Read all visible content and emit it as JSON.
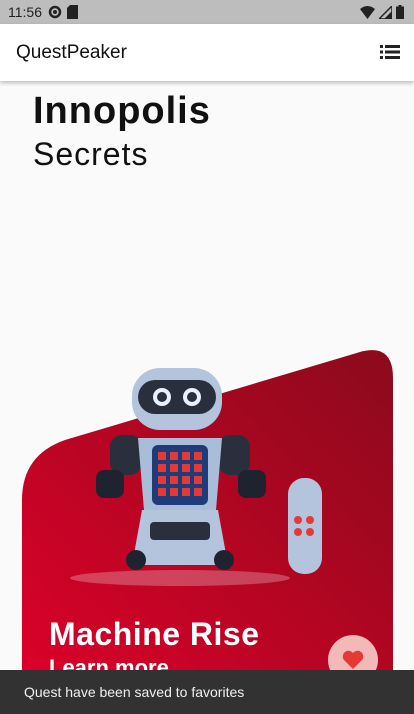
{
  "status_bar": {
    "time": "11:56",
    "icons": [
      "settings-icon",
      "sd-card-icon",
      "wifi-icon",
      "signal-icon",
      "battery-icon"
    ]
  },
  "app_bar": {
    "title": "QuestPeaker",
    "menu_icon": "list-menu-icon"
  },
  "page": {
    "title_line1": "Innopolis",
    "title_line2": "Secrets"
  },
  "card": {
    "title": "Machine Rise",
    "link": "Learn more",
    "favorite_icon": "heart-icon",
    "colors": {
      "gradient_start": "#e0002a",
      "gradient_end": "#8b0a1c",
      "favorite_bg": "#f3b8b8",
      "heart": "#e53935"
    }
  },
  "snackbar": {
    "message": "Quest have been saved to favorites"
  }
}
